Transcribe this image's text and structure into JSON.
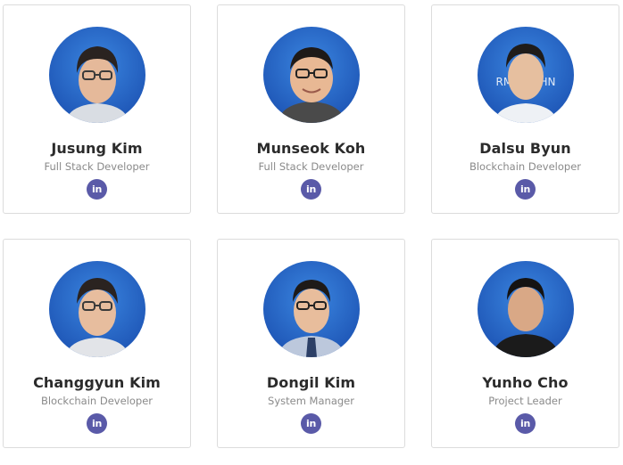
{
  "team": {
    "members": [
      {
        "name": "Jusung Kim",
        "role": "Full Stack Developer",
        "linkedin_label": "in",
        "photo_icon": "portrait-photo"
      },
      {
        "name": "Munseok Koh",
        "role": "Full Stack Developer",
        "linkedin_label": "in",
        "photo_icon": "portrait-photo"
      },
      {
        "name": "Dalsu Byun",
        "role": "Blockchain Developer",
        "linkedin_label": "in",
        "photo_icon": "portrait-photo"
      },
      {
        "name": "Changgyun Kim",
        "role": "Blockchain Developer",
        "linkedin_label": "in",
        "photo_icon": "portrait-photo"
      },
      {
        "name": "Dongil Kim",
        "role": "System Manager",
        "linkedin_label": "in",
        "photo_icon": "portrait-photo"
      },
      {
        "name": "Yunho Cho",
        "role": "Project Leader",
        "linkedin_label": "in",
        "photo_icon": "portrait-photo"
      }
    ],
    "photo_backdrop_text": "RMATI   CHN"
  },
  "colors": {
    "linkedin_badge": "#5a5aa8",
    "name_text": "#2b2b2b",
    "role_text": "#8a8a8a",
    "card_border": "#dcdcdc",
    "photo_background": "#1f5fc0"
  }
}
